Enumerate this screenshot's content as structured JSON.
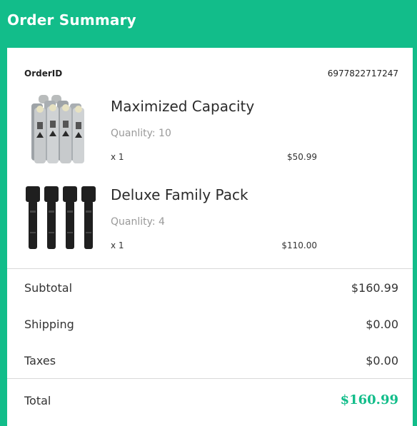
{
  "header": {
    "title": "Order Summary"
  },
  "order": {
    "id_label": "OrderID",
    "id_value": "6977822717247"
  },
  "products": [
    {
      "name": "Maximized Capacity",
      "quantity_text": "Quanlity: 10",
      "multiplier": "x 1",
      "price": "$50.99",
      "thumbnail_icon": "battery-pack-icon"
    },
    {
      "name": "Deluxe Family Pack",
      "quantity_text": "Quanlity: 4",
      "multiplier": "x 1",
      "price": "$110.00",
      "thumbnail_icon": "flashlight-pack-icon"
    }
  ],
  "summary": {
    "subtotal_label": "Subtotal",
    "subtotal_value": "$160.99",
    "shipping_label": "Shipping",
    "shipping_value": "$0.00",
    "taxes_label": "Taxes",
    "taxes_value": "$0.00",
    "total_label": "Total",
    "total_value": "$160.99"
  },
  "colors": {
    "accent": "#12bd8a",
    "card": "#ffffff",
    "divider": "#d9d9d9"
  }
}
